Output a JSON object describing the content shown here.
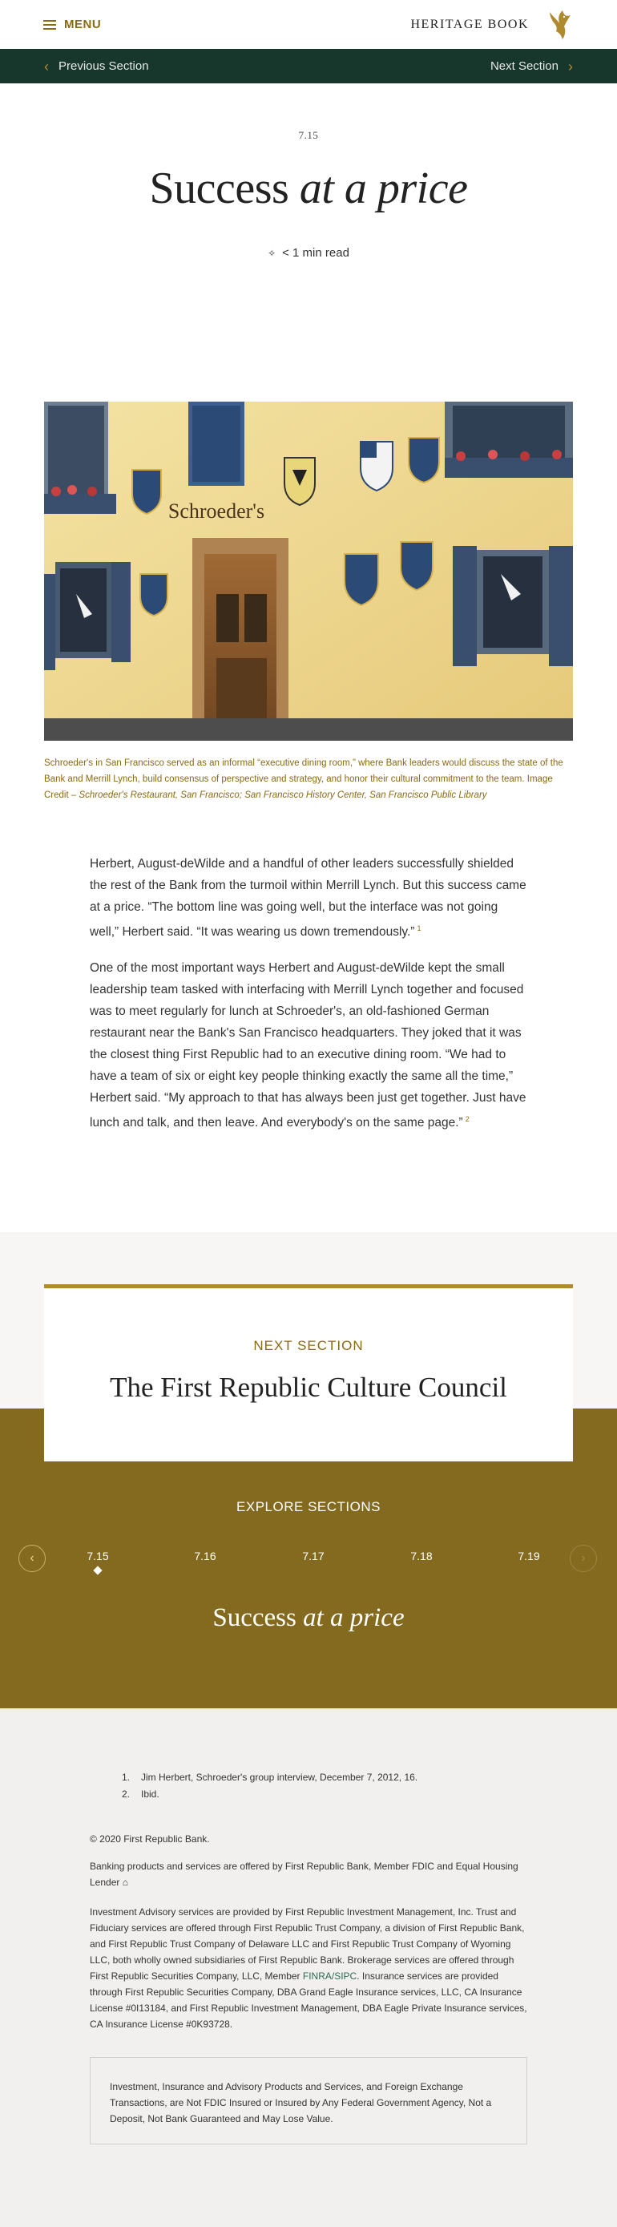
{
  "header": {
    "menu_label": "MENU",
    "brand_title": "HERITAGE BOOK"
  },
  "nav": {
    "prev_label": "Previous Section",
    "next_label": "Next Section"
  },
  "hero": {
    "section_number": "7.15",
    "title_plain": "Success ",
    "title_italic": "at a price",
    "read_time": "< 1 min read"
  },
  "figure": {
    "sign_text": "Schroeder's",
    "caption_plain": "Schroeder's in San Francisco served as an informal “executive dining room,” where Bank leaders would discuss the state of the Bank and Merrill Lynch, build consensus of perspective and strategy, and honor their cultural commitment to the team. Image Credit – ",
    "caption_italic": "Schroeder's Restaurant, San Francisco; San Francisco History Center, San Francisco Public Library"
  },
  "article": {
    "paragraph1": "Herbert, August-deWilde and a handful of other leaders successfully shielded the rest of the Bank from the turmoil within Merrill Lynch. But this success came at a price. “The bottom line was going well, but the interface was not going well,” Herbert said. “It was wearing us down tremendously.”",
    "footnote1": "1",
    "paragraph2": "One of the most important ways Herbert and August-deWilde kept the small leadership team tasked with interfacing with Merrill Lynch together and focused was to meet regularly for lunch at Schroeder's, an old-fashioned German restaurant near the Bank's San Francisco headquarters. They joked that it was the closest thing First Republic had to an executive dining room. “We had to have a team of six or eight key people thinking exactly the same all the time,” Herbert said. “My approach to that has always been just get together. Just have lunch and talk, and then leave. And everybody's on the same page.”",
    "footnote2": "2"
  },
  "next_section": {
    "label": "NEXT SECTION",
    "title": "The First Republic Culture Council"
  },
  "explore": {
    "label": "EXPLORE SECTIONS",
    "items": [
      {
        "label": "7.15"
      },
      {
        "label": "7.16"
      },
      {
        "label": "7.17"
      },
      {
        "label": "7.18"
      },
      {
        "label": "7.19"
      }
    ],
    "active_index": 0,
    "title_plain": "Success ",
    "title_italic": "at a price"
  },
  "footer": {
    "notes": [
      {
        "num": "1.",
        "text": "Jim Herbert, Schroeder's group interview, December 7, 2012, 16."
      },
      {
        "num": "2.",
        "text": "Ibid."
      }
    ],
    "copyright": "© 2020 First Republic Bank.",
    "banking": "Banking products and services are offered by First Republic Bank, Member FDIC and Equal Housing Lender",
    "investment_pre": "Investment Advisory services are provided by First Republic Investment Management, Inc. Trust and Fiduciary services are offered through First Republic Trust Company, a division of First Republic Bank, and First Republic Trust Company of Delaware LLC and First Republic Trust Company of Wyoming LLC, both wholly owned subsidiaries of First Republic Bank. Brokerage services are offered through First Republic Securities Company, LLC, Member ",
    "finra_link": "FINRA/SIPC",
    "investment_post": ". Insurance services are provided through First Republic Securities Company, DBA Grand Eagle Insurance services, LLC, CA Insurance License #0I13184, and First Republic Investment Management, DBA Eagle Private Insurance services, CA Insurance License #0K93728.",
    "disclaimer": "Investment, Insurance and Advisory Products and Services, and Foreign Exchange Transactions, are Not FDIC Insured or Insured by Any Federal Government Agency, Not a Deposit, Not Bank Guaranteed and May Lose Value."
  },
  "colors": {
    "accent_gold": "#8c6a14",
    "nav_green": "#17372d",
    "explore_bg": "#846a1f",
    "link_green": "#2e6a55"
  },
  "icons": {
    "menu": "hamburger-icon",
    "brand": "eagle-logo-icon",
    "prev": "chevron-left-icon",
    "next": "chevron-right-icon",
    "read_time": "sparkle-icon",
    "housing": "equal-housing-icon"
  }
}
